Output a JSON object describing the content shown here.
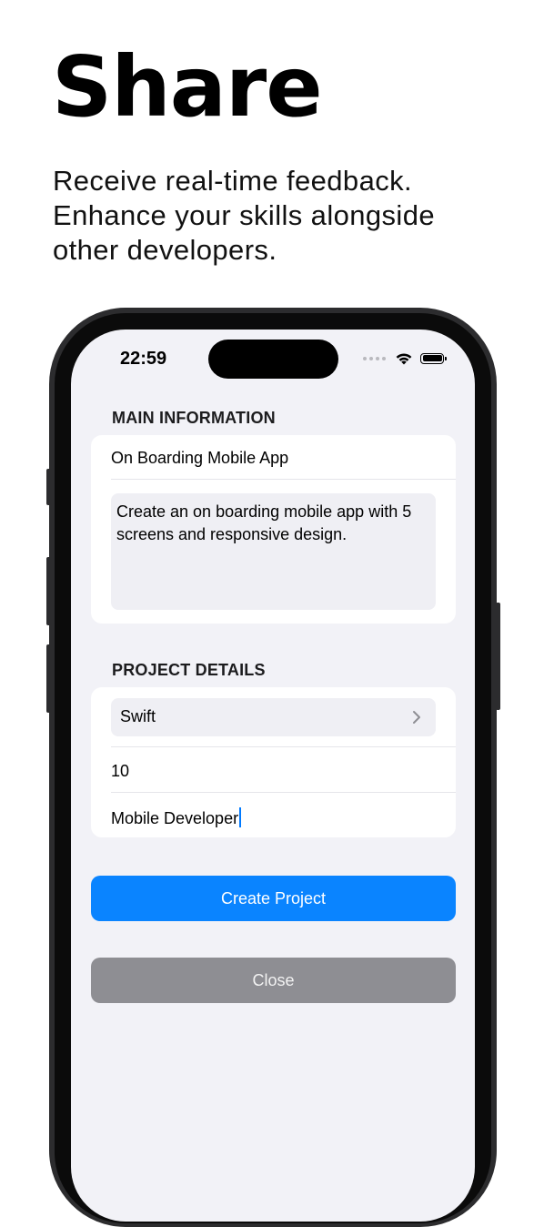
{
  "hero": {
    "title": "Share",
    "subtitle": "Receive real-time feedback. Enhance your skills alongside other developers."
  },
  "status_bar": {
    "time": "22:59",
    "icons": [
      "cellular-dots-icon",
      "wifi-icon",
      "battery-icon"
    ]
  },
  "main_information": {
    "header": "MAIN INFORMATION",
    "project_name": "On Boarding Mobile App",
    "description": "Create an on boarding mobile app with 5 screens and responsive design."
  },
  "project_details": {
    "header": "PROJECT DETAILS",
    "language": "Swift",
    "count": "10",
    "role": "Mobile Developer"
  },
  "actions": {
    "create_label": "Create Project",
    "close_label": "Close"
  },
  "colors": {
    "accent": "#0a84ff",
    "secondary_button": "#8e8e93",
    "screen_background": "#f2f2f7",
    "frame": "#2c2c2e"
  }
}
